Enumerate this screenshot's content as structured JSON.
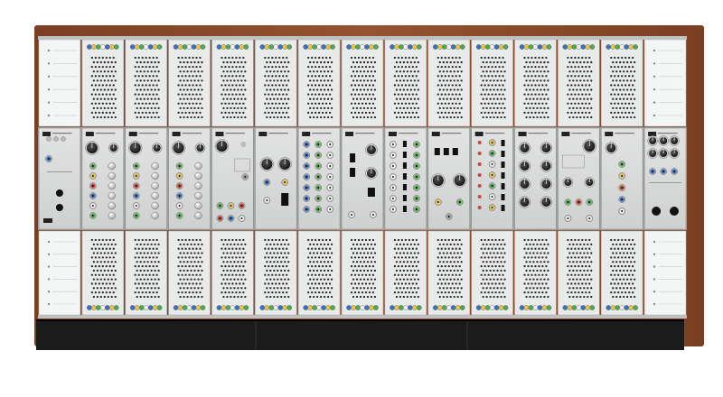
{
  "image": {
    "subject": "modular-synthesizer-cabinet",
    "colors": {
      "wood": "#8a4a2a",
      "wood_dark": "#6b3519",
      "panel": "#e9eaea",
      "panel_light": "#f4f5f5",
      "module": "#d8d9d9",
      "hole": "#2a2a2a",
      "base": "#1c1c1c",
      "jack_blue": "#3d6fbf",
      "jack_yellow": "#e6c64a",
      "jack_green": "#4fa94a",
      "jack_red": "#c8463a",
      "jack_white": "#f2f2f2",
      "jack_gray": "#9a9a9a",
      "knob": "#1e1e1e"
    },
    "columns": 15,
    "side_blanks": [
      "left",
      "right"
    ],
    "module_logo": "AJH"
  }
}
